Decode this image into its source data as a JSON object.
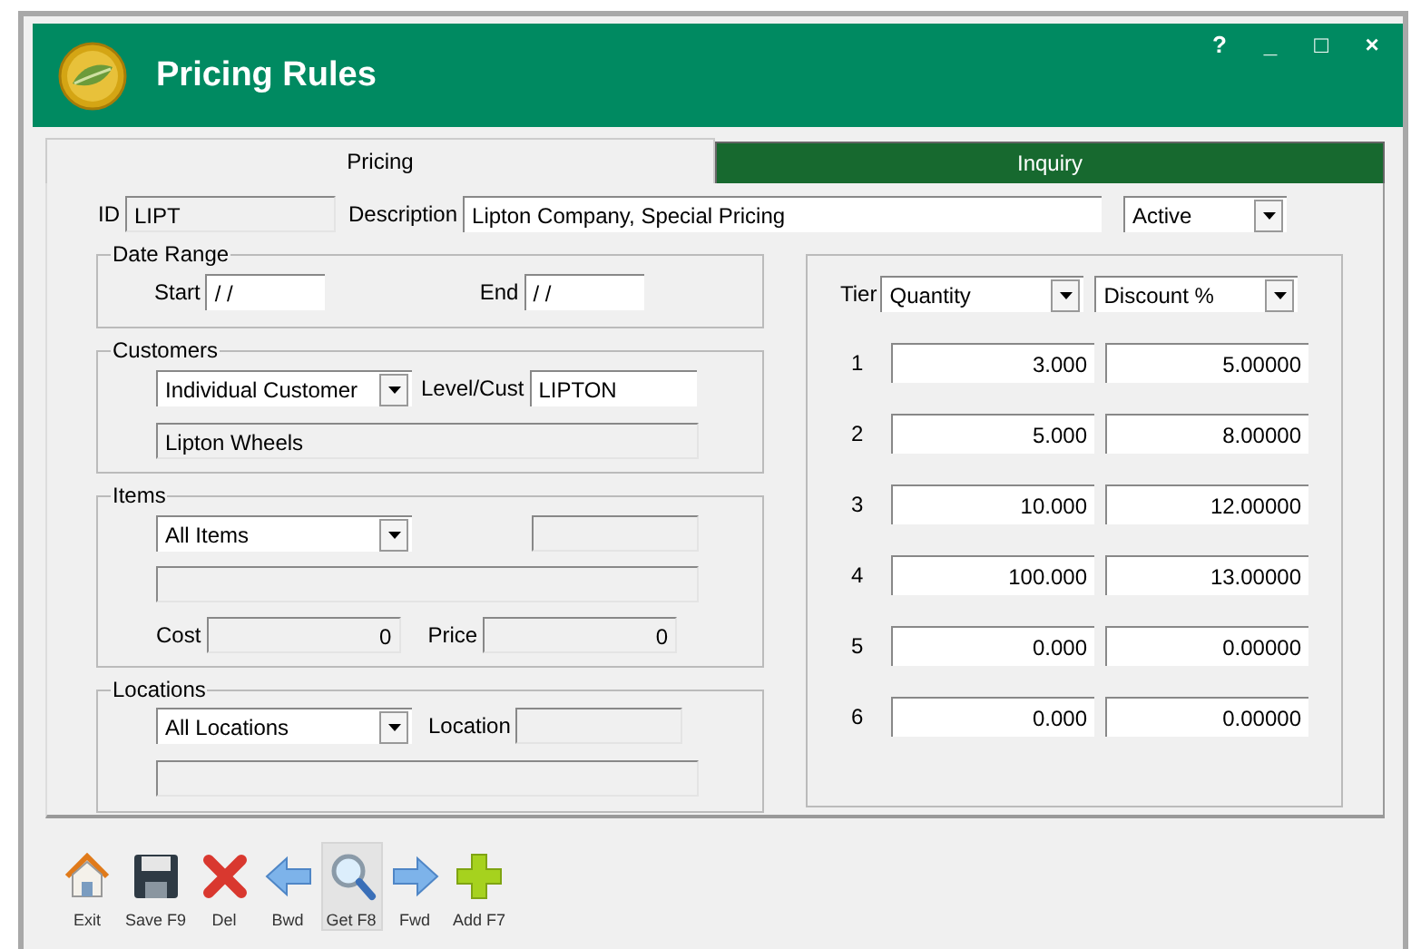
{
  "window": {
    "title": "Pricing Rules",
    "controls": [
      "?",
      "_",
      "□",
      "×"
    ]
  },
  "tabs": [
    {
      "label": "Pricing",
      "selected": true
    },
    {
      "label": "Inquiry",
      "selected": false
    }
  ],
  "header": {
    "id_label": "ID",
    "id": "LIPT",
    "description_label": "Description",
    "description": "Lipton Company, Special Pricing",
    "status": "Active"
  },
  "date_range": {
    "title": "Date Range",
    "start_label": "Start",
    "start": " / /",
    "end_label": "End",
    "end": " / /"
  },
  "customers": {
    "title": "Customers",
    "type": "Individual Customer",
    "level_label": "Level/Cust",
    "level": "LIPTON",
    "name": "Lipton Wheels"
  },
  "items": {
    "title": "Items",
    "type": "All Items",
    "cost_label": "Cost",
    "cost": "0",
    "price_label": "Price",
    "price": "0"
  },
  "locations": {
    "title": "Locations",
    "type": "All Locations",
    "location_label": "Location"
  },
  "tiers": {
    "label": "Tier",
    "basis": "Quantity",
    "mode": "Discount %",
    "rows": [
      {
        "tier": "1",
        "quantity": "3.000",
        "value": "5.00000"
      },
      {
        "tier": "2",
        "quantity": "5.000",
        "value": "8.00000"
      },
      {
        "tier": "3",
        "quantity": "10.000",
        "value": "12.00000"
      },
      {
        "tier": "4",
        "quantity": "100.000",
        "value": "13.00000"
      },
      {
        "tier": "5",
        "quantity": "0.000",
        "value": "0.00000"
      },
      {
        "tier": "6",
        "quantity": "0.000",
        "value": "0.00000"
      }
    ]
  },
  "toolbar": [
    {
      "kind": "home",
      "label": "Exit",
      "highlighted": false
    },
    {
      "kind": "save",
      "label": "Save F9",
      "highlighted": false
    },
    {
      "kind": "delete",
      "label": "Del",
      "highlighted": false
    },
    {
      "kind": "back",
      "label": "Bwd",
      "highlighted": false
    },
    {
      "kind": "search",
      "label": "Get F8",
      "highlighted": true
    },
    {
      "kind": "forward",
      "label": "Fwd",
      "highlighted": false
    },
    {
      "kind": "add",
      "label": "Add F7",
      "highlighted": false
    }
  ]
}
